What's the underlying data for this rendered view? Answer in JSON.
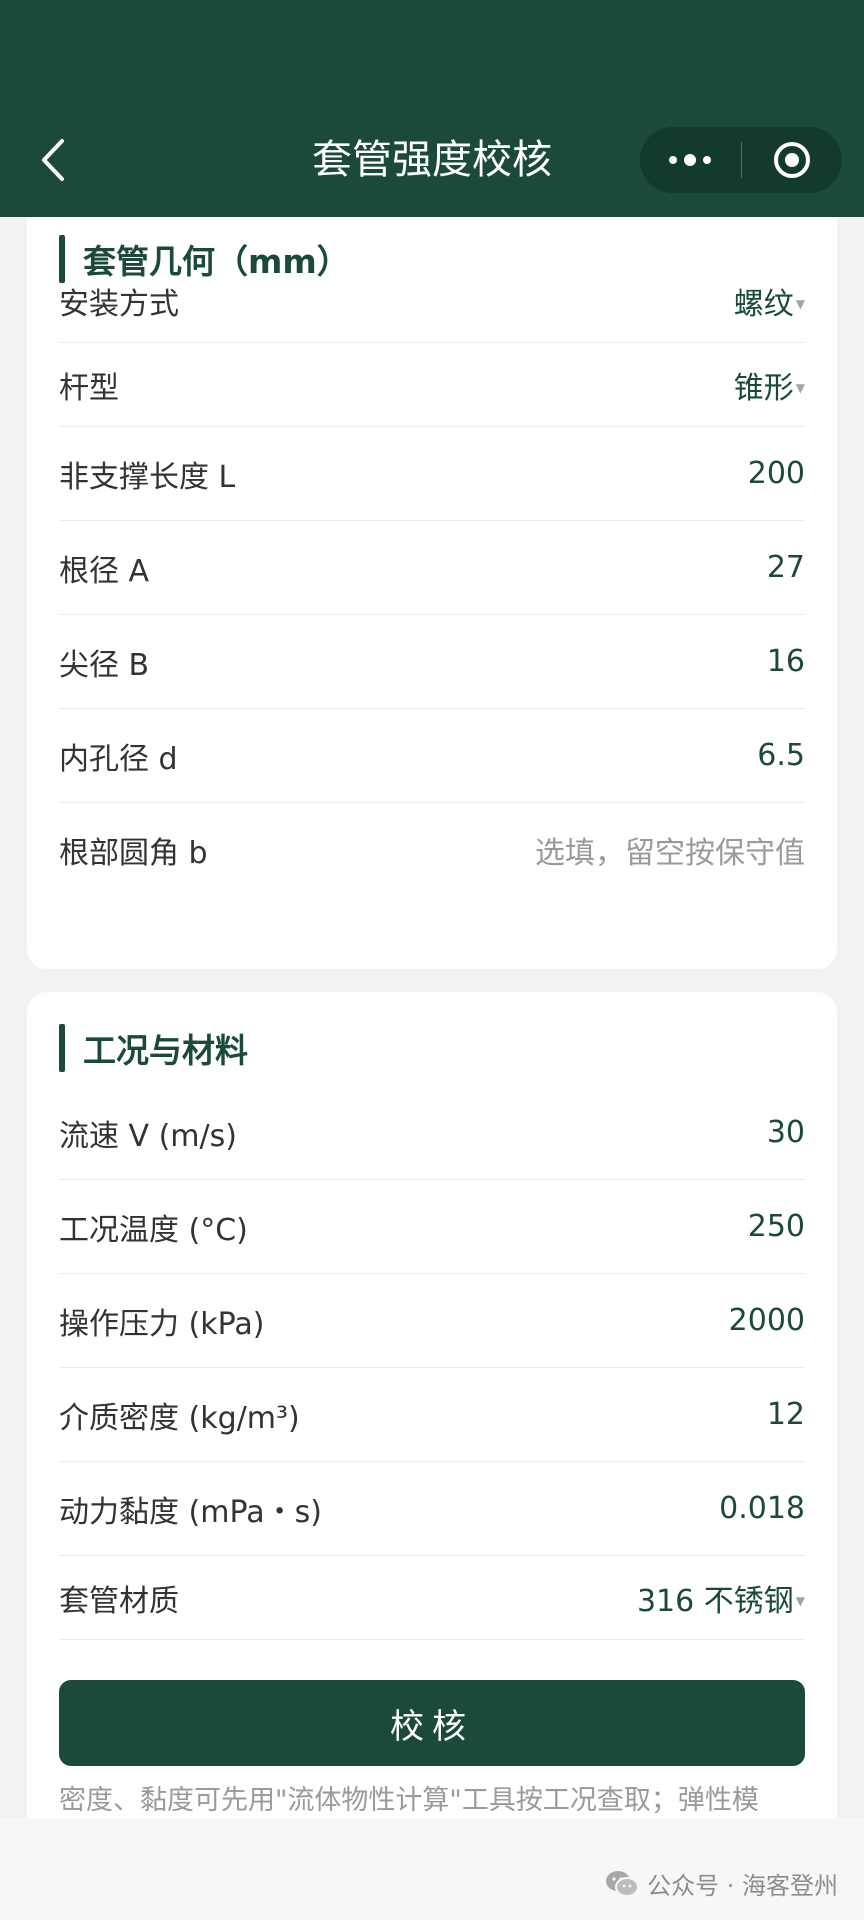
{
  "header": {
    "title": "套管强度校核",
    "back_icon": "chevron-left-icon",
    "more_icon": "more-dots-icon",
    "close_icon": "target-icon"
  },
  "sections": [
    {
      "title": "套管几何（mm）",
      "rows": [
        {
          "label": "安装方式",
          "value": "螺纹",
          "type": "select"
        },
        {
          "label": "杆型",
          "value": "锥形",
          "type": "select"
        },
        {
          "label": "非支撑长度 L",
          "value": "200",
          "type": "input"
        },
        {
          "label": "根径 A",
          "value": "27",
          "type": "input"
        },
        {
          "label": "尖径 B",
          "value": "16",
          "type": "input"
        },
        {
          "label": "内孔径 d",
          "value": "6.5",
          "type": "input"
        },
        {
          "label": "根部圆角 b",
          "placeholder": "选填，留空按保守值",
          "type": "input"
        }
      ]
    },
    {
      "title": "工况与材料",
      "rows": [
        {
          "label": "流速 V (m/s)",
          "value": "30",
          "type": "input"
        },
        {
          "label": "工况温度 (°C)",
          "value": "250",
          "type": "input"
        },
        {
          "label": "操作压力 (kPa)",
          "value": "2000",
          "type": "input"
        },
        {
          "label": "介质密度 (kg/m³)",
          "value": "12",
          "type": "input"
        },
        {
          "label": "动力黏度 (mPa・s)",
          "value": "0.018",
          "type": "input"
        },
        {
          "label": "套管材质",
          "value": "316 不锈钢",
          "type": "select"
        }
      ]
    }
  ],
  "submit_label": "校核",
  "note": "密度、黏度可先用\"流体物性计算\"工具按工况查取；弹性模",
  "watermark": "公众号 · 海客登州",
  "colors": {
    "primary": "#1b4a3c",
    "background": "#f1f3f1",
    "placeholder": "#9a9a9a"
  }
}
